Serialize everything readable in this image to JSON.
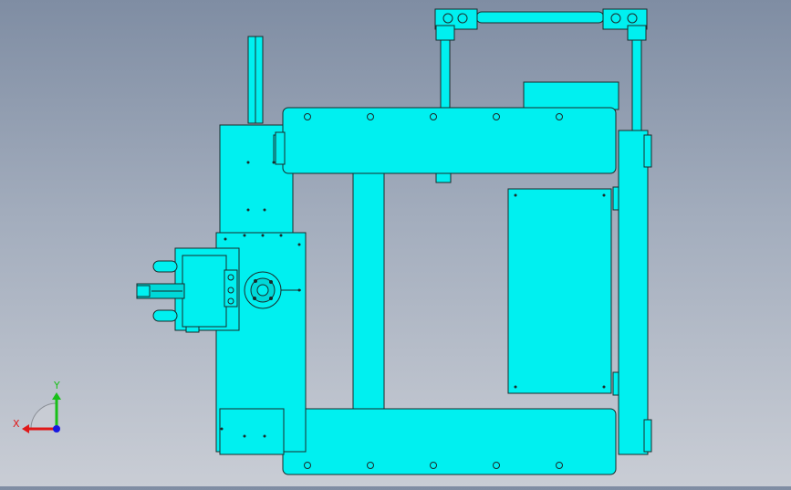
{
  "colors": {
    "part_fill": "#00f0f0",
    "part_edge": "#1a2a2a",
    "background_top": "#7f8da3",
    "background_bottom": "#c9cdd5"
  },
  "triad": {
    "x_label": "X",
    "y_label": "Y",
    "x_color": "#e01818",
    "y_color": "#18c018",
    "z_color": "#1818e0"
  }
}
